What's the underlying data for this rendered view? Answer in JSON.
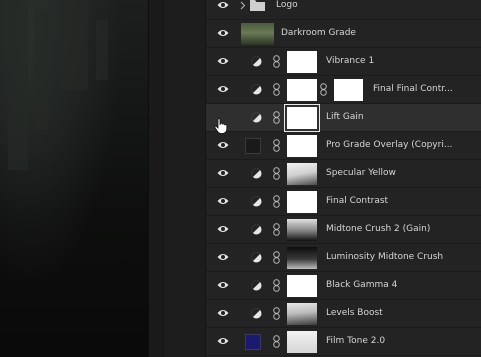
{
  "layers": [
    {
      "name": "Logo",
      "kind": "group",
      "visible": true
    },
    {
      "name": "Darkroom Grade",
      "kind": "image",
      "visible": true
    },
    {
      "name": "Vibrance 1",
      "kind": "adjustment",
      "visible": true
    },
    {
      "name": "Final Final Contr...",
      "kind": "adjustment-double",
      "visible": true
    },
    {
      "name": "Lift Gain",
      "kind": "adjustment",
      "visible": false,
      "selected": true
    },
    {
      "name": "Pro Grade Overlay (Copyri...",
      "kind": "swatch",
      "visible": true,
      "swatch_color": "#1a1a1a"
    },
    {
      "name": "Specular Yellow",
      "kind": "adjustment",
      "visible": true,
      "mask": "curve"
    },
    {
      "name": "Final Contrast",
      "kind": "adjustment",
      "visible": true
    },
    {
      "name": "Midtone Crush 2 (Gain)",
      "kind": "adjustment",
      "visible": true,
      "mask": "dark-bottom"
    },
    {
      "name": "Luminosity Midtone Crush",
      "kind": "adjustment",
      "visible": true,
      "mask": "dark-top"
    },
    {
      "name": "Black Gamma 4",
      "kind": "adjustment",
      "visible": true
    },
    {
      "name": "Levels Boost",
      "kind": "adjustment",
      "visible": true,
      "mask": "curve"
    },
    {
      "name": "Film Tone 2.0",
      "kind": "swatch",
      "visible": true,
      "swatch_color": "#1c1a6e"
    }
  ],
  "colors": {
    "panel": "#232323",
    "selected_row": "#2f2f2f",
    "text": "#d6d6d6"
  }
}
